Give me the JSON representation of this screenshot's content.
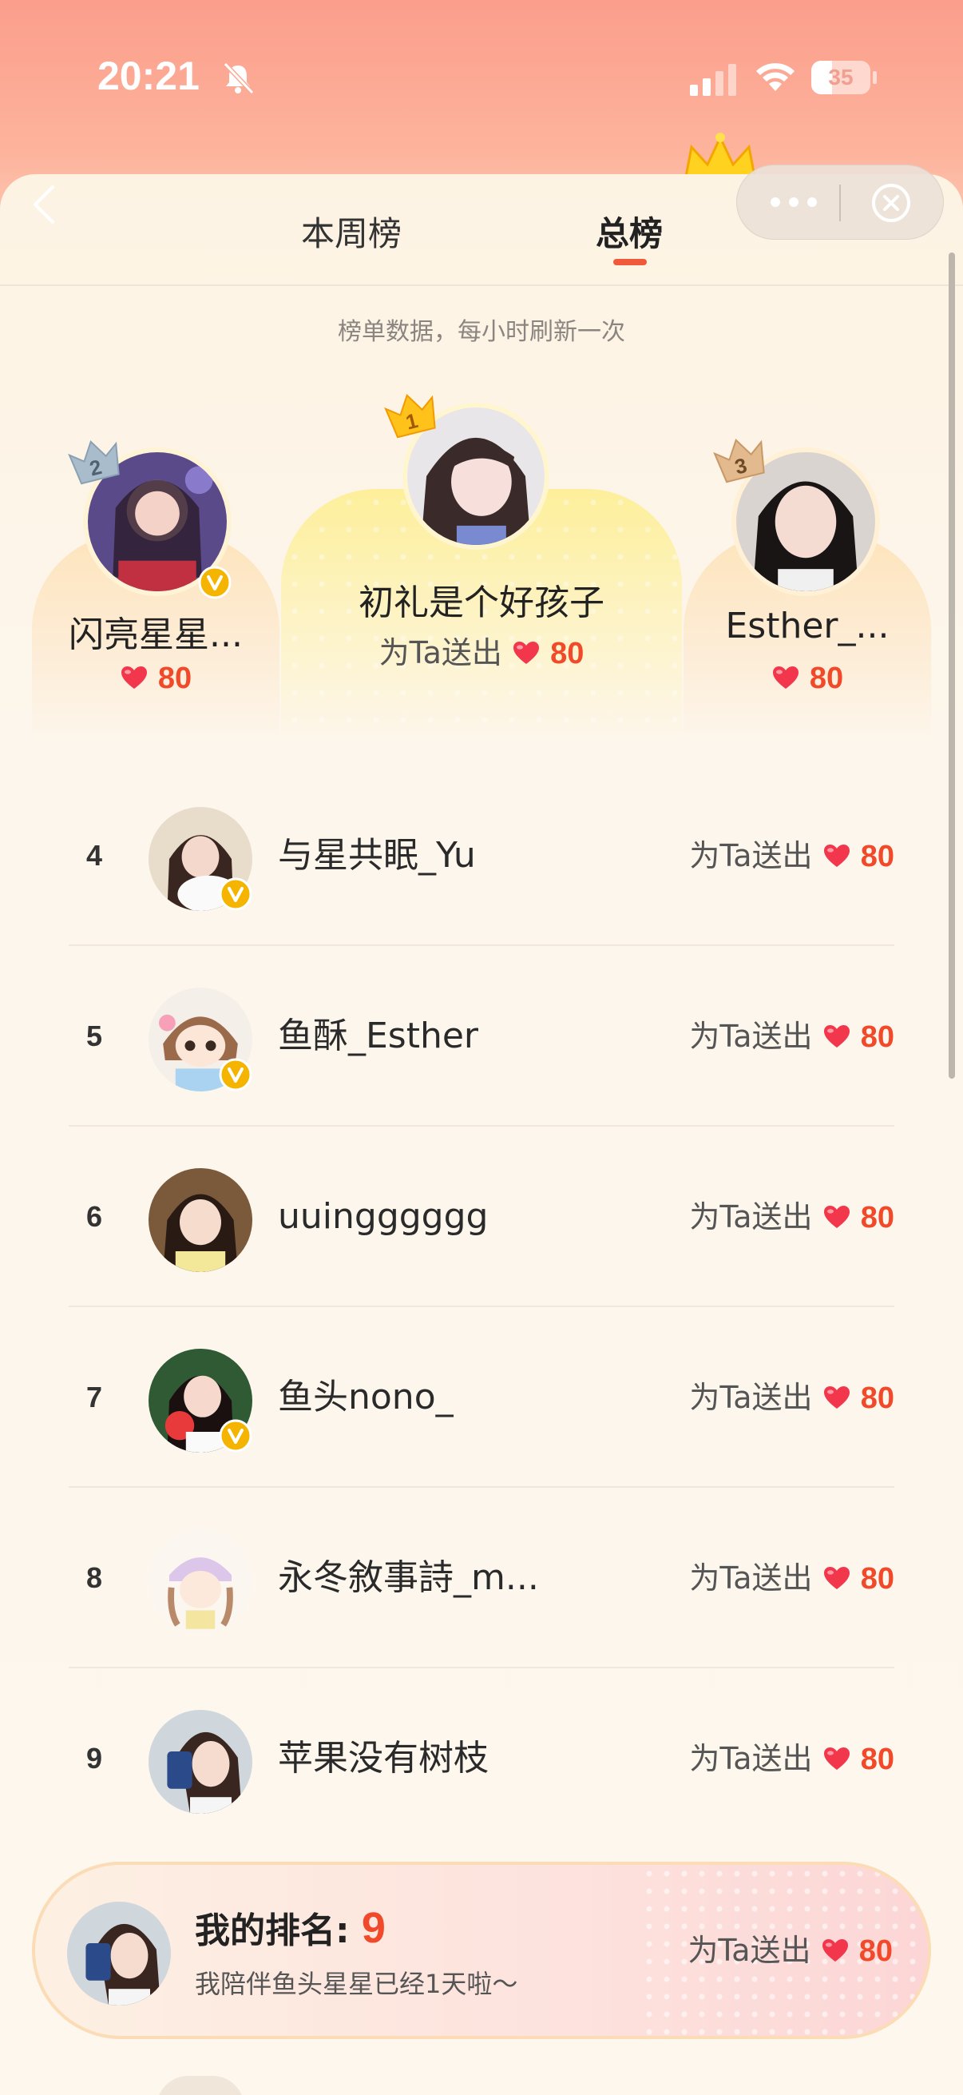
{
  "status_bar": {
    "time": "20:21",
    "battery_level": 35,
    "battery_text": "35",
    "icons": [
      "bell-muted-icon",
      "signal-icon",
      "wifi-icon",
      "battery-icon"
    ]
  },
  "nav": {
    "back_icon": "chevron-left-icon",
    "more_icon": "more-dots-icon",
    "close_icon": "close-circle-icon"
  },
  "tabs": [
    {
      "label": "本周榜",
      "active": false
    },
    {
      "label": "总榜",
      "active": true
    }
  ],
  "refresh_note": "榜单数据，每小时刷新一次",
  "podium": [
    {
      "rank": "1",
      "name": "初礼是个好孩子",
      "prefix": "为Ta送出",
      "score": "80",
      "verified": false
    },
    {
      "rank": "2",
      "name": "闪亮星星...",
      "prefix": "",
      "score": "80",
      "verified": true
    },
    {
      "rank": "3",
      "name": "Esther_...",
      "prefix": "",
      "score": "80",
      "verified": false
    }
  ],
  "list": [
    {
      "rank": "4",
      "name": "与星共眠_Yu",
      "prefix": "为Ta送出",
      "score": "80",
      "verified": true
    },
    {
      "rank": "5",
      "name": "鱼酥_Esther",
      "prefix": "为Ta送出",
      "score": "80",
      "verified": true
    },
    {
      "rank": "6",
      "name": "uuingggggg",
      "prefix": "为Ta送出",
      "score": "80",
      "verified": false
    },
    {
      "rank": "7",
      "name": "鱼头nono_",
      "prefix": "为Ta送出",
      "score": "80",
      "verified": true
    },
    {
      "rank": "8",
      "name": "永冬敘事詩_m...",
      "prefix": "为Ta送出",
      "score": "80",
      "verified": false
    },
    {
      "rank": "9",
      "name": "苹果没有树枝",
      "prefix": "为Ta送出",
      "score": "80",
      "verified": false
    }
  ],
  "my_rank": {
    "label": "我的排名: ",
    "rank": "9",
    "desc": "我陪伴鱼头星星已经1天啦～",
    "prefix": "为Ta送出",
    "score": "80"
  },
  "colors": {
    "accent": "#f04a2a",
    "gold": "#f4b400",
    "header_gradient_top": "#fb9e8c"
  }
}
